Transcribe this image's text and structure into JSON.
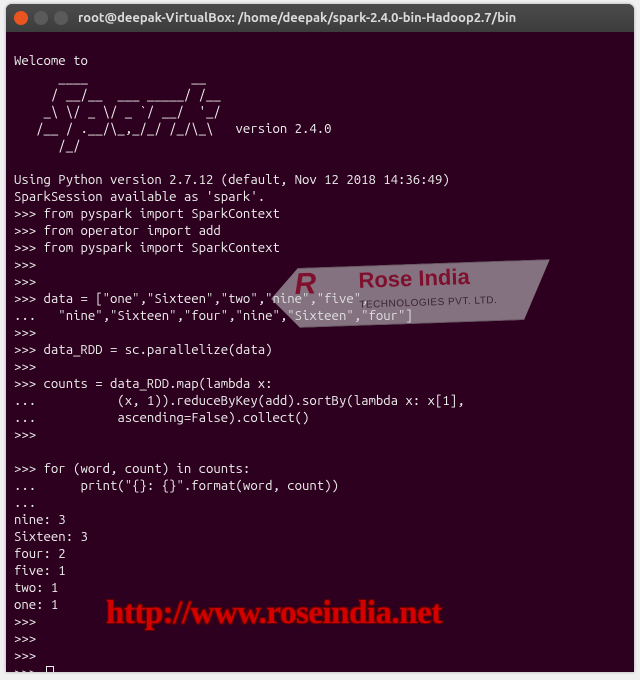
{
  "titlebar": {
    "title": "root@deepak-VirtualBox: /home/deepak/spark-2.4.0-bin-Hadoop2.7/bin"
  },
  "terminal": {
    "welcome": "Welcome to",
    "ascii": "      ____              __\n     / __/__  ___ _____/ /__\n    _\\ \\/ _ \\/ _ `/ __/  '_/\n   /__ / .__/\\_,_/_/ /_/\\_\\   version 2.4.0\n      /_/",
    "py_version": "Using Python version 2.7.12 (default, Nov 12 2018 14:36:49)",
    "session": "SparkSession available as 'spark'.",
    "lines": [
      ">>> from pyspark import SparkContext",
      ">>> from operator import add",
      ">>> from pyspark import SparkContext",
      ">>>",
      ">>>",
      ">>> data = [\"one\",\"Sixteen\",\"two\",\"nine\",\"five\",",
      "...   \"nine\",\"Sixteen\",\"four\",\"nine\",\"Sixteen\",\"four\"]",
      ">>>",
      ">>> data_RDD = sc.parallelize(data)",
      ">>>",
      ">>> counts = data_RDD.map(lambda x:",
      "...           (x, 1)).reduceByKey(add).sortBy(lambda x: x[1],",
      "...           ascending=False).collect()",
      ">>>",
      "",
      ">>> for (word, count) in counts:",
      "...      print(\"{}: {}\".format(word, count))",
      "...",
      "nine: 3",
      "Sixteen: 3",
      "four: 2",
      "five: 1",
      "two: 1",
      "one: 1",
      ">>>",
      ">>>",
      ">>>"
    ],
    "final_prompt": ">>> "
  },
  "watermark": {
    "logo": "R",
    "brand": "Rose India",
    "tagline": "TECHNOLOGIES PVT. LTD."
  },
  "overlay": {
    "url": "http://www.roseindia.net"
  }
}
